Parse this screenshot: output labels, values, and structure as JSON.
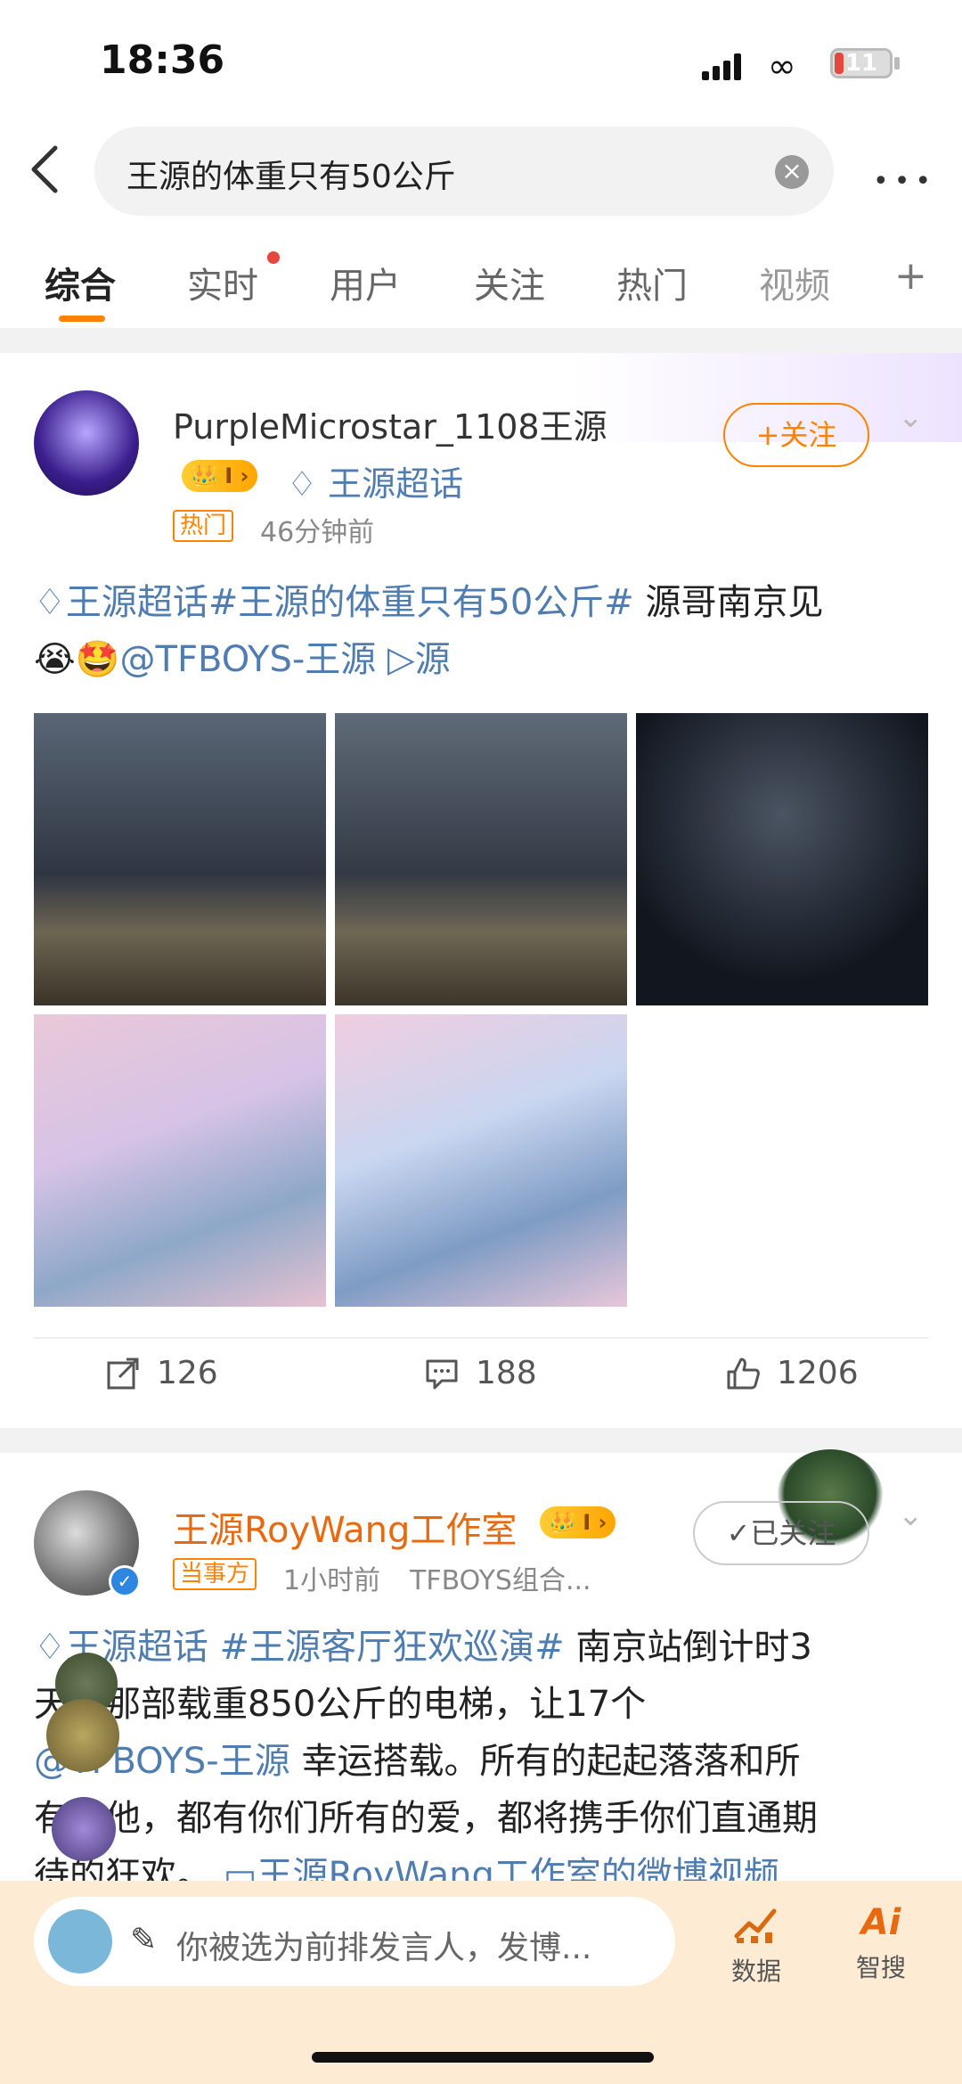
{
  "status": {
    "time": "18:36",
    "battery": "11",
    "colors": {
      "battery_low": "#e8453c"
    }
  },
  "search": {
    "query": "王源的体重只有50公斤",
    "back_icon": "chevron-left-icon",
    "clear_icon": "close-circle-icon",
    "more_icon": "more-dots-icon"
  },
  "tabs": [
    {
      "label": "综合"
    },
    {
      "label": "实时"
    },
    {
      "label": "用户"
    },
    {
      "label": "关注"
    },
    {
      "label": "热门"
    },
    {
      "label": "视频"
    }
  ],
  "tab_add": "+",
  "accent": "#ff8200",
  "post1": {
    "username": "PurpleMicrostar_1108王源",
    "level": "I",
    "supertopic": "王源超话",
    "badge": "热门",
    "time": "46分钟前",
    "follow_label": "+关注",
    "text_topic": "王源超话",
    "text_hashtag": "#王源的体重只有50公斤#",
    "text_plain": " 源哥南京见",
    "text_emoji": "😭🤩",
    "text_mention": "@TFBOYS-王源",
    "text_link": "▷源",
    "reposts": "126",
    "comments": "188",
    "likes": "1206"
  },
  "post2": {
    "username": "王源RoyWang工作室",
    "level": "I",
    "badge": "当事方",
    "time": "1小时前",
    "source": "TFBOYS组合...",
    "follow_label": "已关注",
    "text_line1_topic": "王源超话",
    "text_line1_hashtag": "#王源客厅狂欢巡演#",
    "text_line1_plain": " 南京站倒计时3",
    "text_line2": "天，那部载重850公斤的电梯，让17个",
    "text_line3_mention": "@TFBOYS-王源",
    "text_line3_plain": " 幸运搭载。所有的起起落落和所",
    "text_line4": "有的他，都有你们所有的爱，都将携手你们直通期",
    "text_line5_plain": "待的狂欢。",
    "text_line5_link": "王源RoyWang工作室的微博视频"
  },
  "bottom": {
    "compose_placeholder": "你被选为前排发言人，发博...",
    "tool_data": "数据",
    "tool_ai": "智搜",
    "ai_logo": "Ai"
  }
}
